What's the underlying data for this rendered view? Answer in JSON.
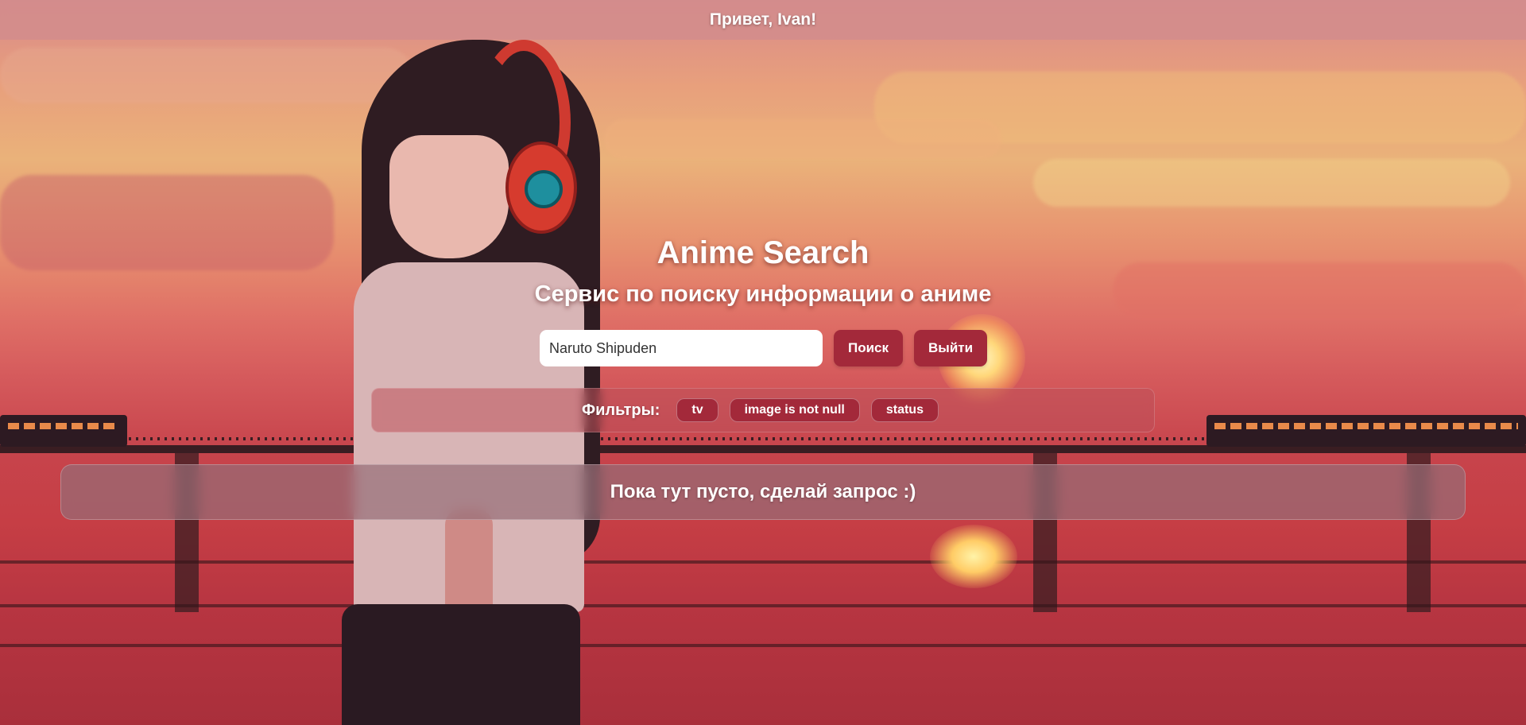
{
  "header": {
    "greeting": "Привет, Ivan!"
  },
  "hero": {
    "title": "Anime Search",
    "subtitle": "Сервис по поиску информации о аниме"
  },
  "search": {
    "value": "Naruto Shipuden",
    "placeholder": "",
    "search_label": "Поиск",
    "logout_label": "Выйти"
  },
  "filters": {
    "label": "Фильтры:",
    "chips": [
      "tv",
      "image is not null",
      "status"
    ]
  },
  "results": {
    "empty_message": "Пока тут пусто, сделай запрос :)"
  },
  "colors": {
    "accent": "#a3293a",
    "topbar": "#d28c8c"
  },
  "background": {
    "icons": [
      "headphones-icon"
    ]
  }
}
